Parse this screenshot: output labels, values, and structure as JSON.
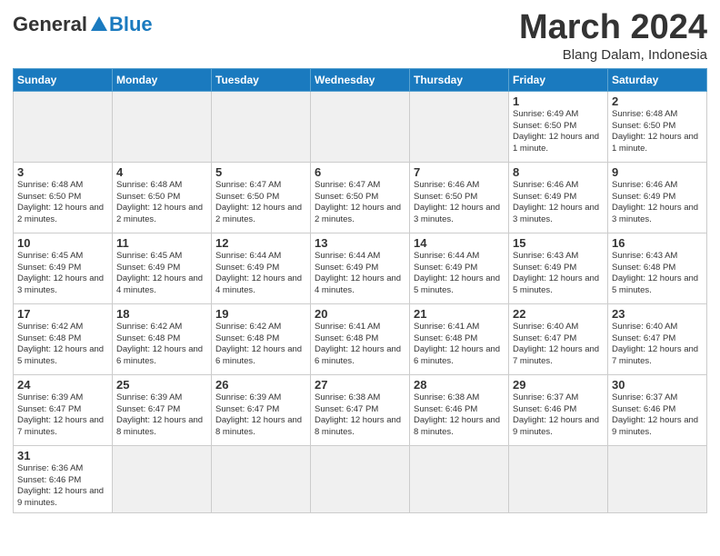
{
  "logo": {
    "general": "General",
    "blue": "Blue"
  },
  "title": "March 2024",
  "subtitle": "Blang Dalam, Indonesia",
  "days": [
    "Sunday",
    "Monday",
    "Tuesday",
    "Wednesday",
    "Thursday",
    "Friday",
    "Saturday"
  ],
  "weeks": [
    [
      {
        "date": "",
        "info": "",
        "empty": true
      },
      {
        "date": "",
        "info": "",
        "empty": true
      },
      {
        "date": "",
        "info": "",
        "empty": true
      },
      {
        "date": "",
        "info": "",
        "empty": true
      },
      {
        "date": "",
        "info": "",
        "empty": true
      },
      {
        "date": "1",
        "info": "Sunrise: 6:49 AM\nSunset: 6:50 PM\nDaylight: 12 hours and 1 minute."
      },
      {
        "date": "2",
        "info": "Sunrise: 6:48 AM\nSunset: 6:50 PM\nDaylight: 12 hours and 1 minute."
      }
    ],
    [
      {
        "date": "3",
        "info": "Sunrise: 6:48 AM\nSunset: 6:50 PM\nDaylight: 12 hours and 2 minutes."
      },
      {
        "date": "4",
        "info": "Sunrise: 6:48 AM\nSunset: 6:50 PM\nDaylight: 12 hours and 2 minutes."
      },
      {
        "date": "5",
        "info": "Sunrise: 6:47 AM\nSunset: 6:50 PM\nDaylight: 12 hours and 2 minutes."
      },
      {
        "date": "6",
        "info": "Sunrise: 6:47 AM\nSunset: 6:50 PM\nDaylight: 12 hours and 2 minutes."
      },
      {
        "date": "7",
        "info": "Sunrise: 6:46 AM\nSunset: 6:50 PM\nDaylight: 12 hours and 3 minutes."
      },
      {
        "date": "8",
        "info": "Sunrise: 6:46 AM\nSunset: 6:49 PM\nDaylight: 12 hours and 3 minutes."
      },
      {
        "date": "9",
        "info": "Sunrise: 6:46 AM\nSunset: 6:49 PM\nDaylight: 12 hours and 3 minutes."
      }
    ],
    [
      {
        "date": "10",
        "info": "Sunrise: 6:45 AM\nSunset: 6:49 PM\nDaylight: 12 hours and 3 minutes."
      },
      {
        "date": "11",
        "info": "Sunrise: 6:45 AM\nSunset: 6:49 PM\nDaylight: 12 hours and 4 minutes."
      },
      {
        "date": "12",
        "info": "Sunrise: 6:44 AM\nSunset: 6:49 PM\nDaylight: 12 hours and 4 minutes."
      },
      {
        "date": "13",
        "info": "Sunrise: 6:44 AM\nSunset: 6:49 PM\nDaylight: 12 hours and 4 minutes."
      },
      {
        "date": "14",
        "info": "Sunrise: 6:44 AM\nSunset: 6:49 PM\nDaylight: 12 hours and 5 minutes."
      },
      {
        "date": "15",
        "info": "Sunrise: 6:43 AM\nSunset: 6:49 PM\nDaylight: 12 hours and 5 minutes."
      },
      {
        "date": "16",
        "info": "Sunrise: 6:43 AM\nSunset: 6:48 PM\nDaylight: 12 hours and 5 minutes."
      }
    ],
    [
      {
        "date": "17",
        "info": "Sunrise: 6:42 AM\nSunset: 6:48 PM\nDaylight: 12 hours and 5 minutes."
      },
      {
        "date": "18",
        "info": "Sunrise: 6:42 AM\nSunset: 6:48 PM\nDaylight: 12 hours and 6 minutes."
      },
      {
        "date": "19",
        "info": "Sunrise: 6:42 AM\nSunset: 6:48 PM\nDaylight: 12 hours and 6 minutes."
      },
      {
        "date": "20",
        "info": "Sunrise: 6:41 AM\nSunset: 6:48 PM\nDaylight: 12 hours and 6 minutes."
      },
      {
        "date": "21",
        "info": "Sunrise: 6:41 AM\nSunset: 6:48 PM\nDaylight: 12 hours and 6 minutes."
      },
      {
        "date": "22",
        "info": "Sunrise: 6:40 AM\nSunset: 6:47 PM\nDaylight: 12 hours and 7 minutes."
      },
      {
        "date": "23",
        "info": "Sunrise: 6:40 AM\nSunset: 6:47 PM\nDaylight: 12 hours and 7 minutes."
      }
    ],
    [
      {
        "date": "24",
        "info": "Sunrise: 6:39 AM\nSunset: 6:47 PM\nDaylight: 12 hours and 7 minutes."
      },
      {
        "date": "25",
        "info": "Sunrise: 6:39 AM\nSunset: 6:47 PM\nDaylight: 12 hours and 8 minutes."
      },
      {
        "date": "26",
        "info": "Sunrise: 6:39 AM\nSunset: 6:47 PM\nDaylight: 12 hours and 8 minutes."
      },
      {
        "date": "27",
        "info": "Sunrise: 6:38 AM\nSunset: 6:47 PM\nDaylight: 12 hours and 8 minutes."
      },
      {
        "date": "28",
        "info": "Sunrise: 6:38 AM\nSunset: 6:46 PM\nDaylight: 12 hours and 8 minutes."
      },
      {
        "date": "29",
        "info": "Sunrise: 6:37 AM\nSunset: 6:46 PM\nDaylight: 12 hours and 9 minutes."
      },
      {
        "date": "30",
        "info": "Sunrise: 6:37 AM\nSunset: 6:46 PM\nDaylight: 12 hours and 9 minutes."
      }
    ],
    [
      {
        "date": "31",
        "info": "Sunrise: 6:36 AM\nSunset: 6:46 PM\nDaylight: 12 hours and 9 minutes."
      },
      {
        "date": "",
        "info": "",
        "empty": true
      },
      {
        "date": "",
        "info": "",
        "empty": true
      },
      {
        "date": "",
        "info": "",
        "empty": true
      },
      {
        "date": "",
        "info": "",
        "empty": true
      },
      {
        "date": "",
        "info": "",
        "empty": true
      },
      {
        "date": "",
        "info": "",
        "empty": true
      }
    ]
  ]
}
